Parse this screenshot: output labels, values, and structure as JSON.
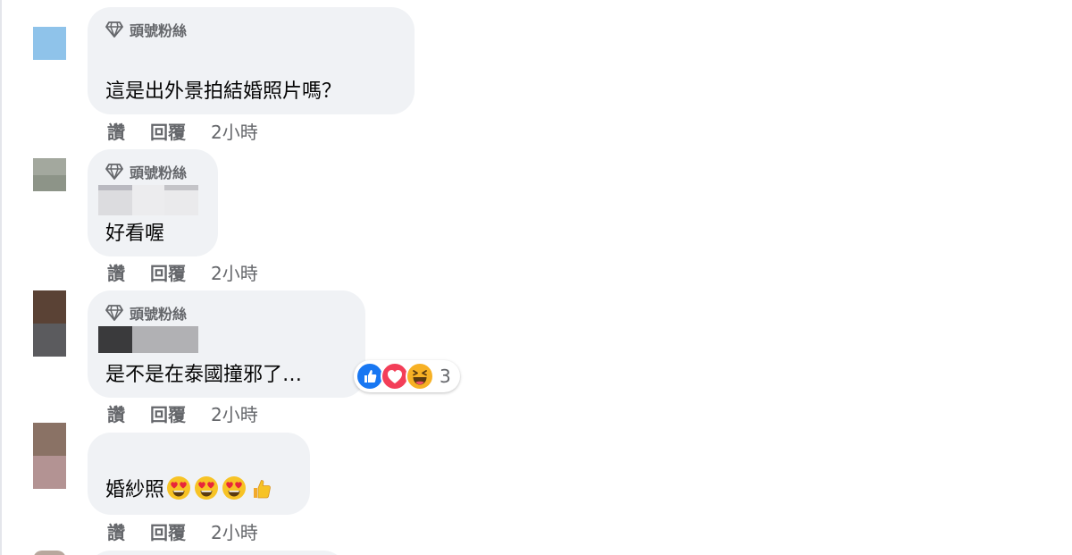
{
  "comments": [
    {
      "badge": "頭號粉絲",
      "text": "這是出外景拍結婚照片嗎？",
      "actions": {
        "like": "讚",
        "reply": "回覆",
        "time": "2小時"
      }
    },
    {
      "badge": "頭號粉絲",
      "text": "好看喔",
      "actions": {
        "like": "讚",
        "reply": "回覆",
        "time": "2小時"
      }
    },
    {
      "badge": "頭號粉絲",
      "text": "是不是在泰國撞邪了…",
      "reactions": {
        "icons": [
          "like-icon",
          "love-icon",
          "haha-icon"
        ],
        "count": "3"
      },
      "actions": {
        "like": "讚",
        "reply": "回覆",
        "time": "2小時"
      }
    },
    {
      "text": "婚紗照",
      "emojis": [
        "heart-eyes-icon",
        "heart-eyes-icon",
        "heart-eyes-icon",
        "thumbs-up-icon"
      ],
      "actions": {
        "like": "讚",
        "reply": "回覆",
        "time": "2小時"
      }
    }
  ],
  "colors": {
    "bubble": "#f0f2f5",
    "muted_text": "#65676b",
    "primary_text": "#050505",
    "like_blue": "#1877f2",
    "love_red": "#f33e58",
    "haha_yellow": "#f7b125"
  }
}
